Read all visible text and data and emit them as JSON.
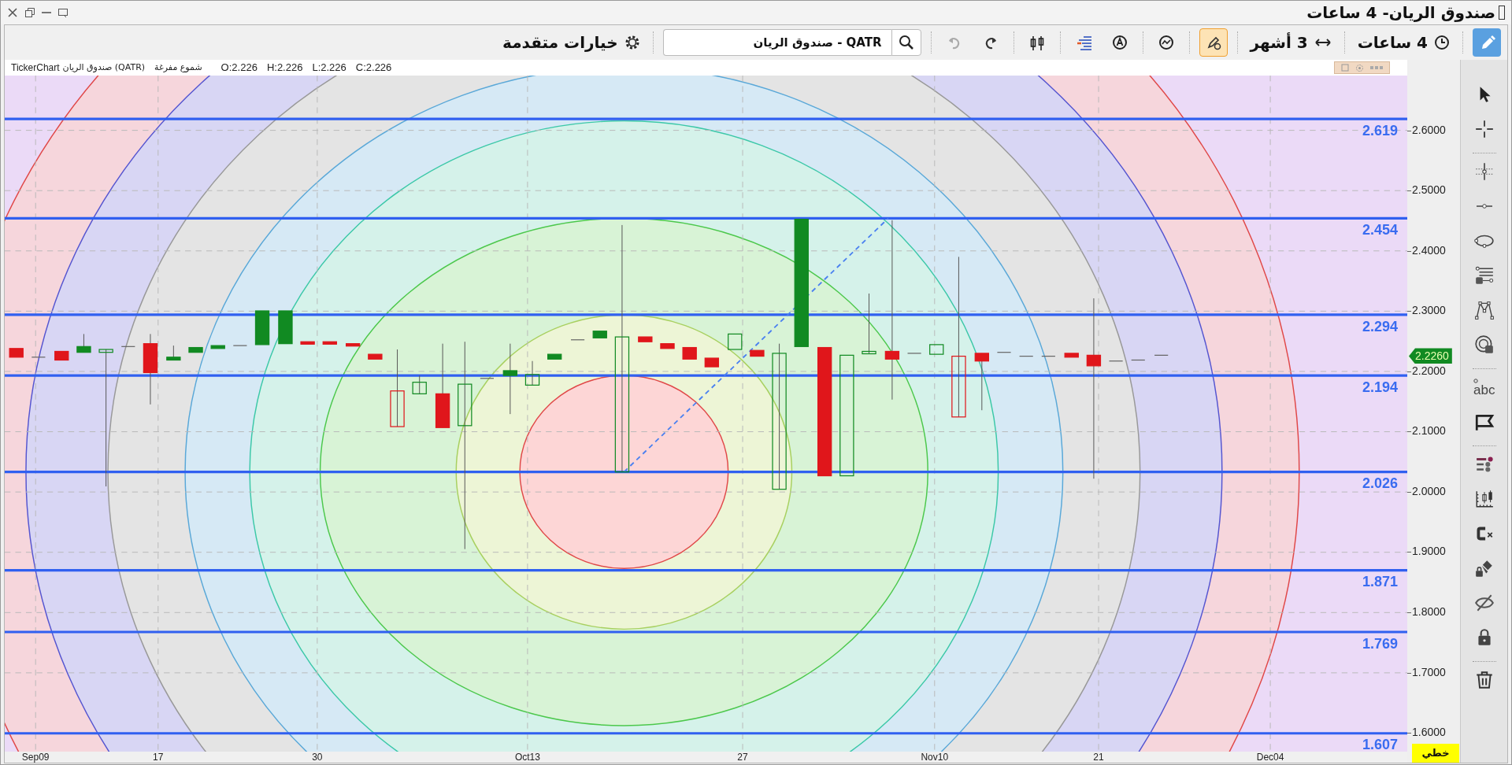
{
  "window": {
    "title": "صندوق الريان- 4 ساعات"
  },
  "toolbar": {
    "items": [
      {
        "kind": "draw",
        "active": true
      },
      {
        "kind": "interval",
        "label": "4 ساعات"
      },
      {
        "kind": "period",
        "label": "3 أشهر"
      },
      {
        "kind": "drawing-settings",
        "active": true
      },
      {
        "kind": "indicator"
      },
      {
        "kind": "alert"
      },
      {
        "kind": "bars"
      },
      {
        "kind": "chart-settings"
      },
      {
        "kind": "redo",
        "disabled": false
      },
      {
        "kind": "undo",
        "disabled": true
      },
      {
        "kind": "symbol",
        "value": "QATR - صندوق الريان"
      },
      {
        "kind": "advanced",
        "label": "خيارات متقدمة"
      }
    ]
  },
  "info_line": {
    "app": "TickerChart",
    "symbol": "صندوق الريان (QATR)",
    "chart_type": "شموع مفرغة",
    "ohlc": [
      "O:2.226",
      "H:2.226",
      "L:2.226",
      "C:2.226"
    ]
  },
  "chart": {
    "fib_levels": [
      "2.619",
      "2.454",
      "2.294",
      "2.194",
      "2.026",
      "1.871",
      "1.769",
      "1.607"
    ],
    "price_ticks": [
      "2.6000",
      "2.5000",
      "2.4000",
      "2.3000",
      "2.2000",
      "2.1000",
      "2.0000",
      "1.9000",
      "1.8000",
      "1.7000",
      "1.6000"
    ],
    "last_price": "2.2260",
    "scale_mode": "خطي",
    "date_labels": [
      "Sep09",
      "17",
      "30",
      "Oct13",
      "27",
      "Nov10",
      "21",
      "Dec04"
    ]
  },
  "side_tools": [
    {
      "kind": "cursor"
    },
    {
      "kind": "crosshair"
    },
    {
      "kind": "separator"
    },
    {
      "kind": "crosshair-dotted"
    },
    {
      "kind": "line"
    },
    {
      "kind": "ellipse"
    },
    {
      "kind": "fib"
    },
    {
      "kind": "pattern"
    },
    {
      "kind": "fib-circle"
    },
    {
      "kind": "separator"
    },
    {
      "kind": "text",
      "label": "abc"
    },
    {
      "kind": "flag"
    },
    {
      "kind": "separator"
    },
    {
      "kind": "layers"
    },
    {
      "kind": "candle-scale"
    },
    {
      "kind": "clear"
    },
    {
      "kind": "lock-drawing"
    },
    {
      "kind": "hide"
    },
    {
      "kind": "lock"
    },
    {
      "kind": "separator"
    },
    {
      "kind": "trash"
    }
  ]
}
